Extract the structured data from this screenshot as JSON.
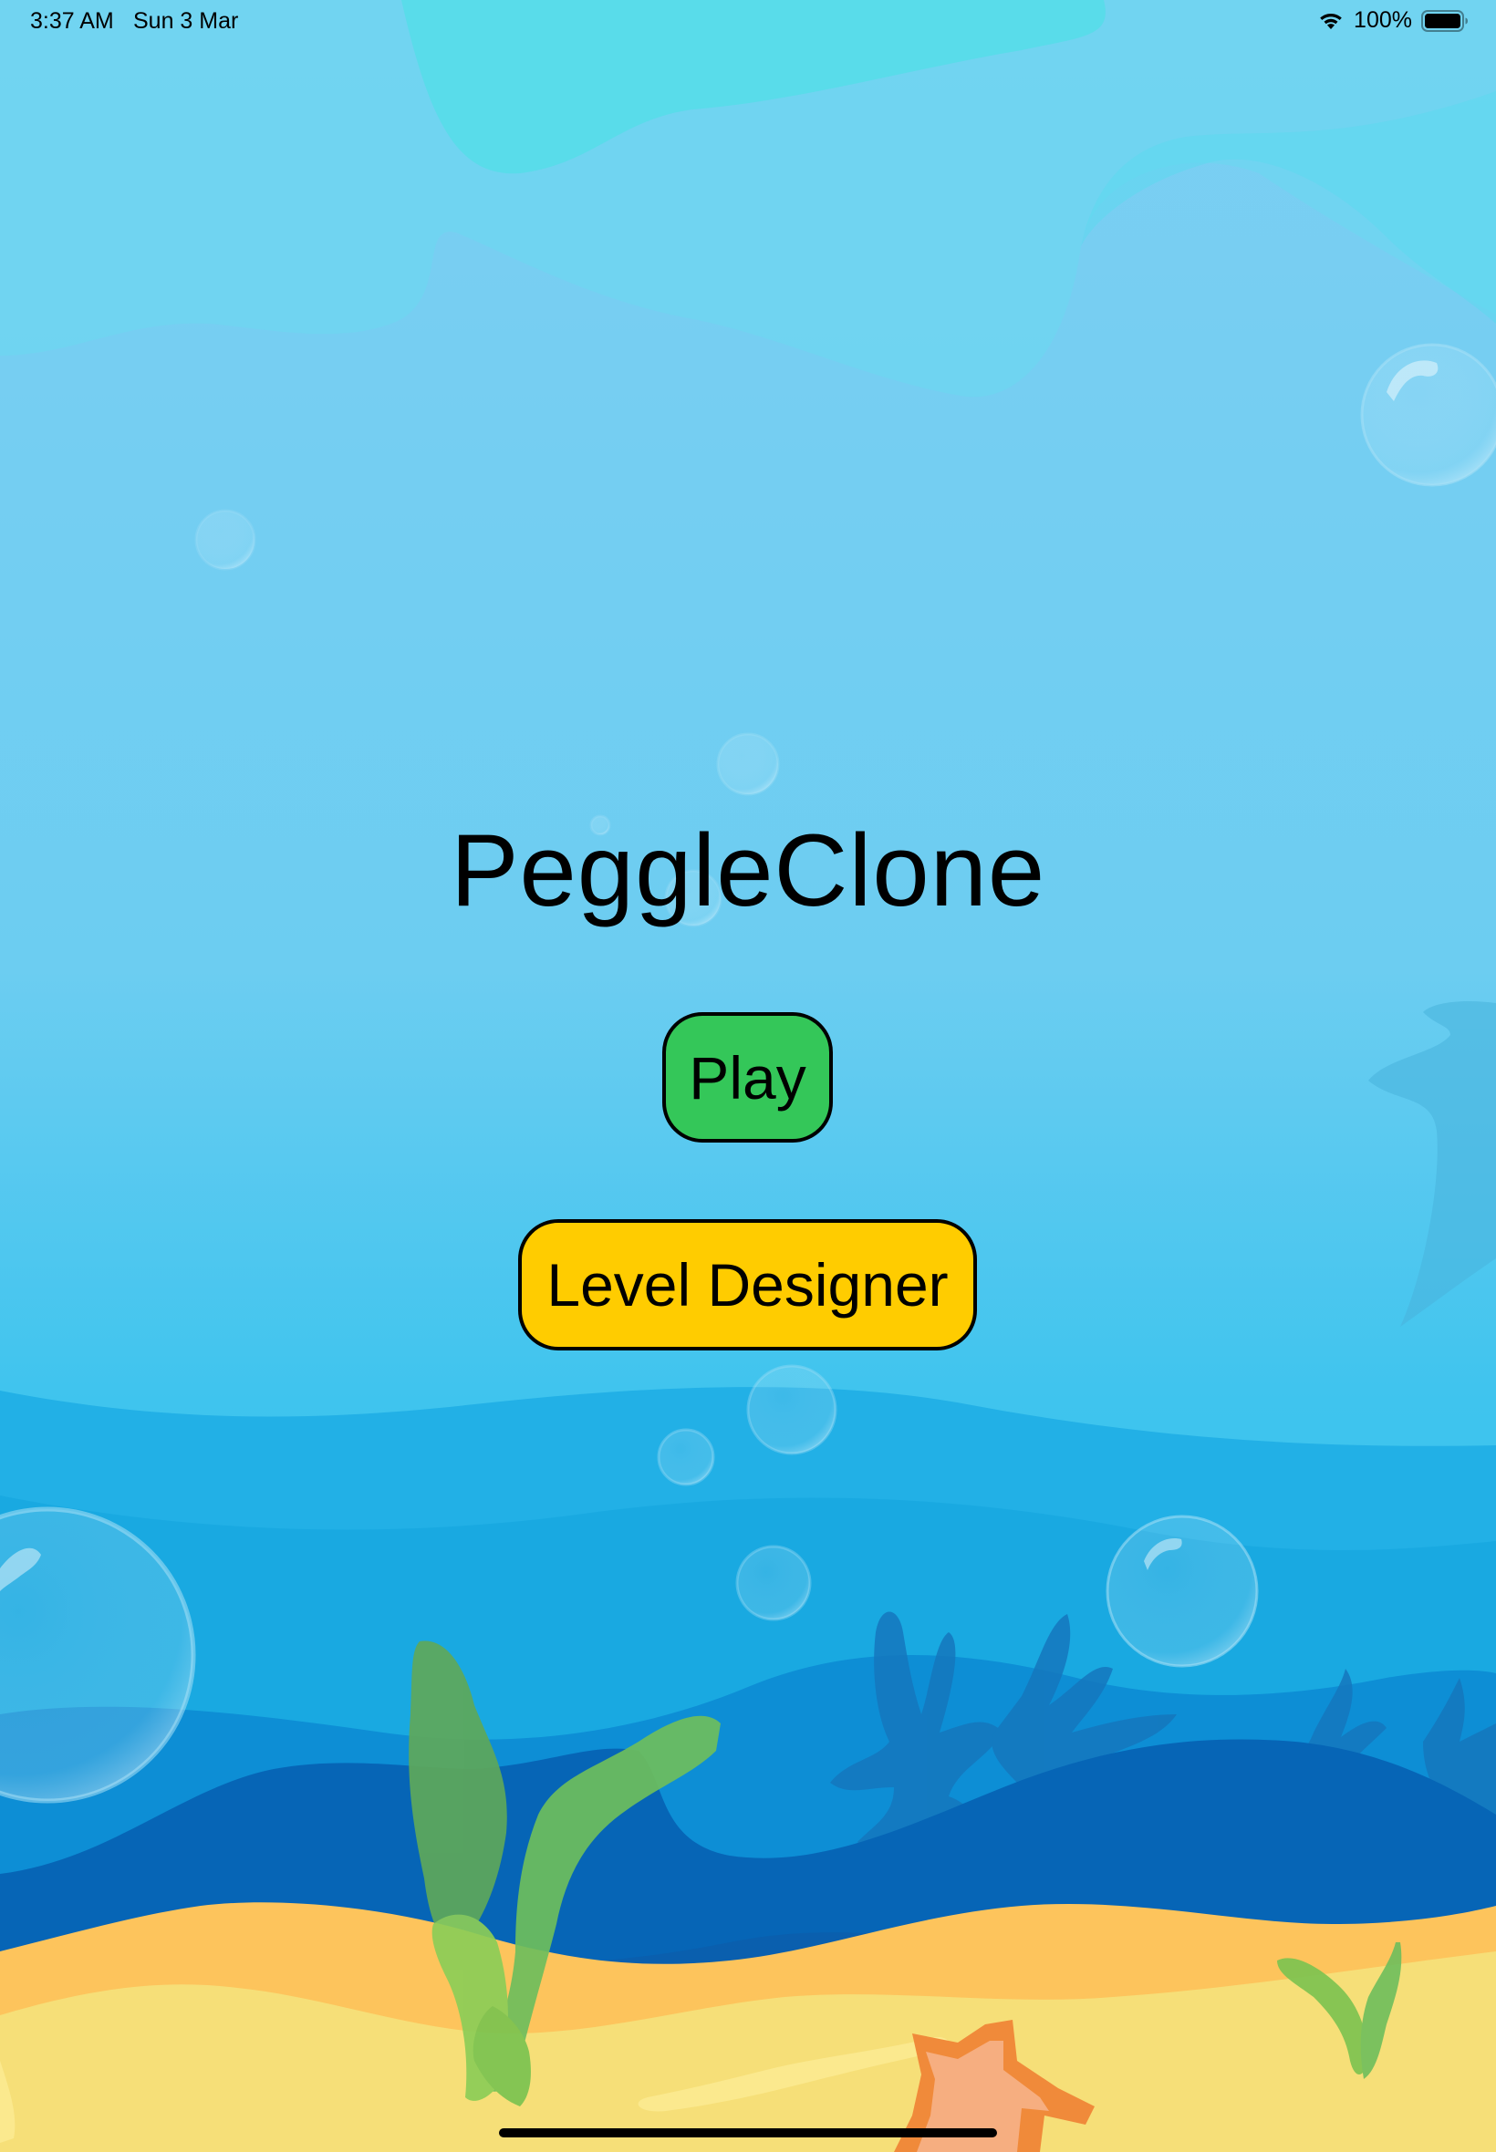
{
  "status_bar": {
    "time": "3:37 AM",
    "date": "Sun 3 Mar",
    "battery_percent": "100%",
    "battery_level": 1.0,
    "wifi_icon": "wifi-icon",
    "battery_icon": "battery-icon"
  },
  "menu": {
    "title": "PeggleClone",
    "play_label": "Play",
    "level_designer_label": "Level Designer"
  },
  "colors": {
    "play_button": "#34c759",
    "level_designer_button": "#ffcc00",
    "water_light": "#7dd0f3",
    "water_mid": "#2fc3ec",
    "water_deep": "#0a6fc0",
    "sand": "#f6df78",
    "sand_edge": "#fdc45c"
  }
}
